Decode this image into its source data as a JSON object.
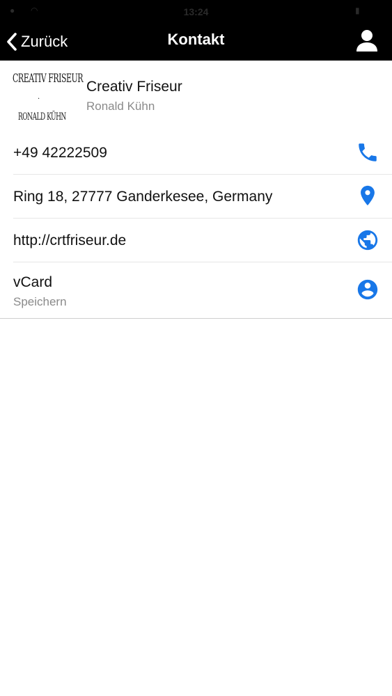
{
  "status_bar": {
    "time": "13:24"
  },
  "nav": {
    "back_label": "Zurück",
    "title": "Kontakt"
  },
  "contact": {
    "logo_line1": "CREATIV FRISEUR",
    "logo_dot": "·",
    "logo_line2": "RONALD KÜHN",
    "business_name": "Creativ Friseur",
    "owner_name": "Ronald Kühn"
  },
  "rows": {
    "phone": "+49 42222509",
    "address": "Ring 18, 27777 Ganderkesee, Germany",
    "website": "http://crtfriseur.de",
    "vcard_title": "vCard",
    "vcard_subtitle": "Speichern"
  },
  "colors": {
    "accent": "#1877e8",
    "nav_background": "#000000",
    "secondary_text": "#8a8a8a"
  },
  "icons": {
    "back": "chevron-left-icon",
    "profile": "person-icon",
    "phone": "phone-icon",
    "address": "map-pin-icon",
    "website": "globe-icon",
    "vcard": "account-circle-icon"
  }
}
